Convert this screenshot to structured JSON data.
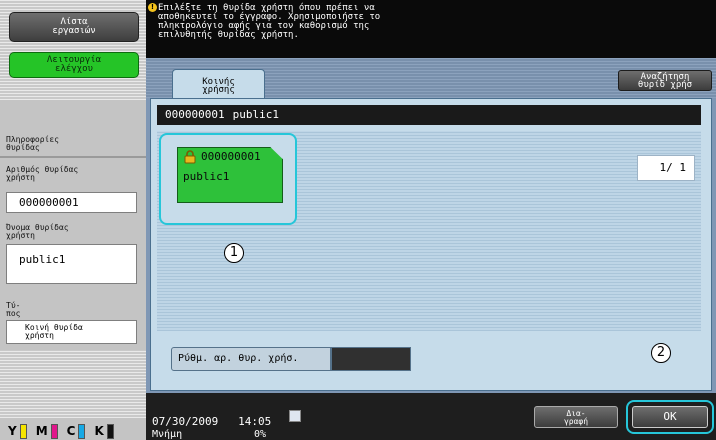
{
  "left_panel": {
    "work_button": "Λίστα\nεργασιών",
    "function_button": "Λειτουργία\nελέγχου",
    "box_info_header": "Πληροφορίες\nθυρίδας",
    "box_number_label": "Αριθμός θυρίδας\nχρήστη",
    "box_number_value": "000000001",
    "box_name_label": "Όνομα θυρίδας\nχρήστη",
    "box_name_value": "public1",
    "type_label": "Τύ-\nπος",
    "type_value": "Κοινή θυρίδα\nχρήστη",
    "toner": [
      {
        "letter": "Y",
        "color": "#f5e400"
      },
      {
        "letter": "M",
        "color": "#e0168b"
      },
      {
        "letter": "C",
        "color": "#16a9e5"
      },
      {
        "letter": "K",
        "color": "#111111"
      }
    ]
  },
  "header": {
    "message": "Επιλέξτε τη θυρίδα χρήστη όπου πρέπει να\nαποθηκευτεί το έγγραφο. Χρησιμοποιήστε το\nπληκτρολόγιο αφής για τον καθορισμό της\nεπιλυθητής θυρίδας χρήστη."
  },
  "main": {
    "tab_label": "Κοινής\nχρήσης",
    "search_button": "Αναζήτηση\nθυρίδ χρήσ",
    "selected_number": "000000001",
    "selected_name": "public1",
    "box": {
      "number": "000000001",
      "name": "public1"
    },
    "page_indicator": "1/ 1",
    "callout_1": "1",
    "callout_2": "2",
    "box_setting_button": "Ρύθμ. αρ. θυρ. χρήσ."
  },
  "bottom": {
    "datetime": "07/30/2009   14:05",
    "memory_label": "Μνήμη",
    "memory_value": "0%",
    "clear_button": "Δια-\nγραφή",
    "ok_button": "OK"
  }
}
